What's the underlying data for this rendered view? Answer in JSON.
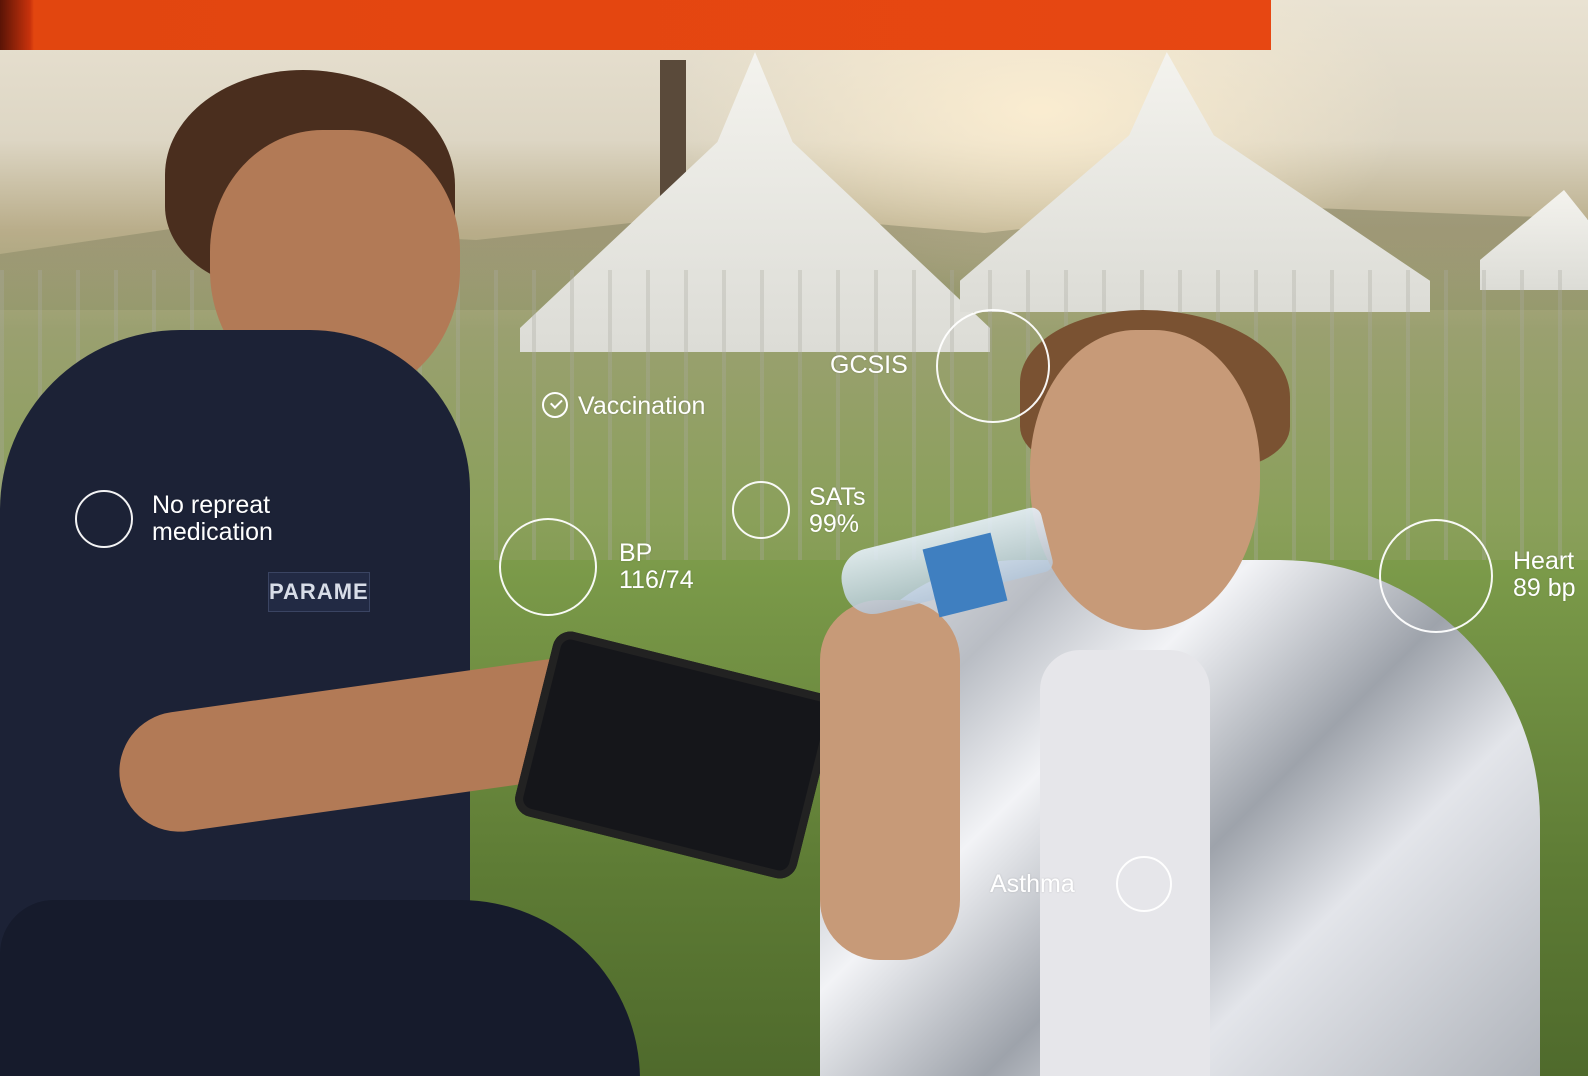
{
  "banner": {
    "color": "#e74712"
  },
  "scene": {
    "badge_text": "PARAMEDIC"
  },
  "annotations": {
    "no_repeat_medication": "No repreat\nmedication",
    "vaccination": "Vaccination",
    "gcsis": "GCSIS",
    "sats_label": "SATs",
    "sats_value": "99%",
    "bp_label": "BP",
    "bp_value": "116/74",
    "heart_label": "Heart",
    "heart_value": "89 bp",
    "asthma": "Asthma"
  }
}
